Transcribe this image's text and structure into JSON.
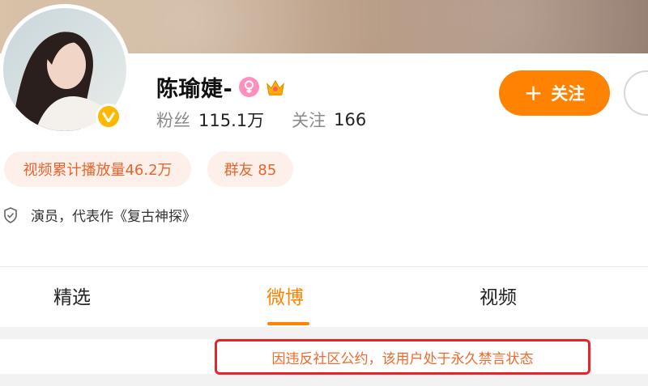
{
  "profile": {
    "name": "陈瑜婕-",
    "fans_label": "粉丝",
    "fans_value": "115.1万",
    "following_label": "关注",
    "following_value": "166",
    "bio": "演员，代表作《复古神探》"
  },
  "actions": {
    "follow_label": "关注"
  },
  "pills": {
    "video_plays": "视频累计播放量46.2万",
    "group_friends": "群友 85"
  },
  "tabs": [
    {
      "label": "精选"
    },
    {
      "label": "微博"
    },
    {
      "label": "视频"
    }
  ],
  "active_tab": "微博",
  "notice": "因违反社区公约，该用户处于永久禁言状态",
  "colors": {
    "accent": "#ff8200",
    "verified": "#ffb800",
    "female_badge": "#ff8fbd",
    "notice_border": "#e8242a",
    "notice_text": "#ee6a2b"
  },
  "icons": [
    "verified-icon",
    "female-icon",
    "crown-icon",
    "plus-icon",
    "shield-check-icon"
  ]
}
